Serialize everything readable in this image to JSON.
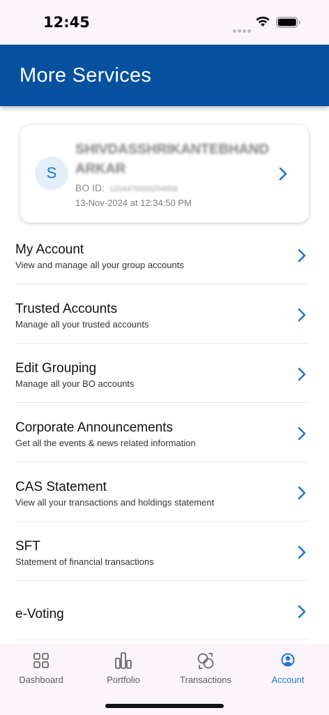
{
  "status_bar": {
    "time": "12:45"
  },
  "header": {
    "title": "More Services"
  },
  "profile": {
    "initial": "S",
    "name": "SHIVDASSHRIKANTEBHANDARKAR",
    "bo_label": "BO ID:",
    "bo_id": "1204470000254958",
    "timestamp": "13-Nov-2024 at 12:34:50 PM"
  },
  "menu": {
    "items": [
      {
        "title": "My Account",
        "subtitle": "View and manage all your group accounts"
      },
      {
        "title": "Trusted Accounts",
        "subtitle": "Manage all your trusted accounts"
      },
      {
        "title": "Edit Grouping",
        "subtitle": "Manage all your BO accounts"
      },
      {
        "title": "Corporate Announcements",
        "subtitle": "Get all the events & news related information"
      },
      {
        "title": "CAS Statement",
        "subtitle": "View all your transactions and holdings statement"
      },
      {
        "title": "SFT",
        "subtitle": "Statement of financial transactions"
      },
      {
        "title": "e-Voting",
        "subtitle": ""
      }
    ]
  },
  "tabs": [
    {
      "label": "Dashboard",
      "icon": "grid-icon"
    },
    {
      "label": "Portfolio",
      "icon": "bar-chart-icon"
    },
    {
      "label": "Transactions",
      "icon": "exchange-icon"
    },
    {
      "label": "Account",
      "icon": "user-circle-icon",
      "active": true
    }
  ],
  "colors": {
    "brand": "#06519f",
    "accent": "#1f73d8"
  }
}
